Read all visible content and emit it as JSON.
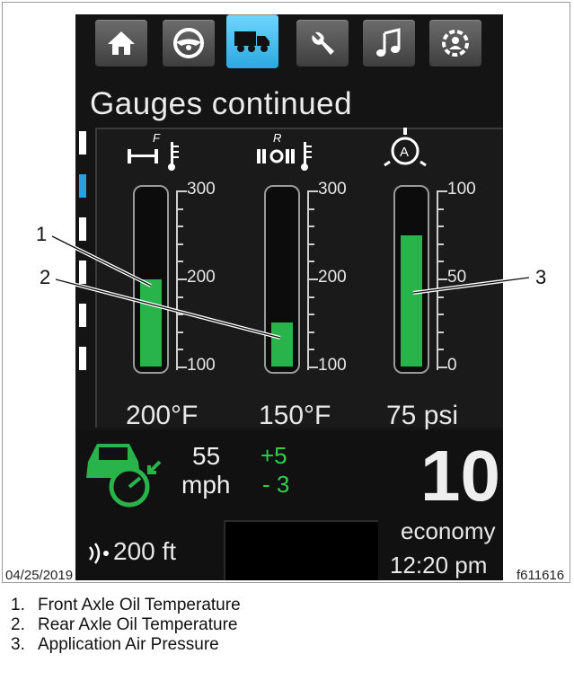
{
  "screen": {
    "title": "Gauges continued",
    "tabs": [
      {
        "icon": "home-icon",
        "active": false
      },
      {
        "icon": "steering-wheel-icon",
        "active": false
      },
      {
        "icon": "truck-icon",
        "active": true
      },
      {
        "icon": "wrench-icon",
        "active": false
      },
      {
        "icon": "music-note-icon",
        "active": false
      },
      {
        "icon": "settings-person-icon",
        "active": false
      }
    ],
    "gauges": [
      {
        "icon": "front-axle-temp-icon",
        "icon_letter": "F",
        "reading": "200°F",
        "ticks": [
          "300",
          "200",
          "100"
        ],
        "fill_fraction": 0.5
      },
      {
        "icon": "rear-axle-temp-icon",
        "icon_letter": "R",
        "reading": "150°F",
        "ticks": [
          "300",
          "200",
          "100"
        ],
        "fill_fraction": 0.25
      },
      {
        "icon": "air-pressure-icon",
        "icon_letter": "A",
        "reading": "75 psi",
        "ticks": [
          "100",
          "50",
          "0"
        ],
        "fill_fraction": 0.75
      }
    ],
    "cruise": {
      "speed": "55",
      "unit": "mph",
      "plus": "+5",
      "minus": "- 3"
    },
    "following_distance": "200 ft",
    "score": "10",
    "score_label": "economy",
    "time": "12:20 pm",
    "colors": {
      "accent": "#2aa9e0",
      "gauge_fill": "#28b44a",
      "status_green": "#2fd04a"
    }
  },
  "callouts": [
    "1",
    "2",
    "3"
  ],
  "footer": {
    "date": "04/25/2019",
    "figure_id": "f611616"
  },
  "legend": [
    {
      "num": "1.",
      "text": "Front Axle Oil Temperature"
    },
    {
      "num": "2.",
      "text": "Rear Axle Oil Temperature"
    },
    {
      "num": "3.",
      "text": "Application Air Pressure"
    }
  ]
}
